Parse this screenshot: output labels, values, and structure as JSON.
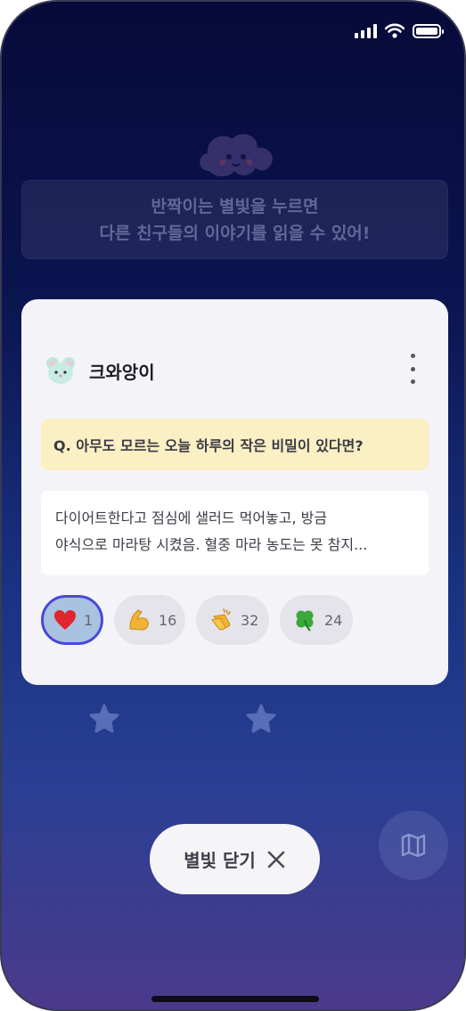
{
  "status_bar": {
    "signal_icon": "signal-icon",
    "wifi_icon": "wifi-icon",
    "battery_icon": "battery-icon"
  },
  "banner": {
    "line1": "반짝이는 별빛을 누르면",
    "line2": "다른 친구들의 이야기를 읽을 수 있어!"
  },
  "card": {
    "username": "크와앙이",
    "avatar_icon": "mouse-avatar-icon",
    "more_icon": "more-vertical-icon",
    "question": "Q. 아무도 모르는 오늘 하루의 작은 비밀이 있다면?",
    "answer_line1": "다이어트한다고 점심에 샐러드 먹어놓고, 방금",
    "answer_line2": "야식으로 마라탕 시켰음. 혈중 마라 농도는 못 참지...",
    "reactions": [
      {
        "icon": "heart-icon",
        "count": "1",
        "selected": true
      },
      {
        "icon": "flexed-biceps-icon",
        "count": "16",
        "selected": false
      },
      {
        "icon": "clapping-hands-icon",
        "count": "32",
        "selected": false
      },
      {
        "icon": "four-leaf-clover-icon",
        "count": "24",
        "selected": false
      }
    ]
  },
  "close_button": {
    "label": "별빛 닫기",
    "icon": "close-icon"
  },
  "map_button": {
    "icon": "map-icon"
  },
  "colors": {
    "accent_selected_border": "#4a48d8",
    "question_bg": "#fbefc4",
    "background_top": "#070a3a",
    "background_bottom": "#4c3a8c"
  }
}
